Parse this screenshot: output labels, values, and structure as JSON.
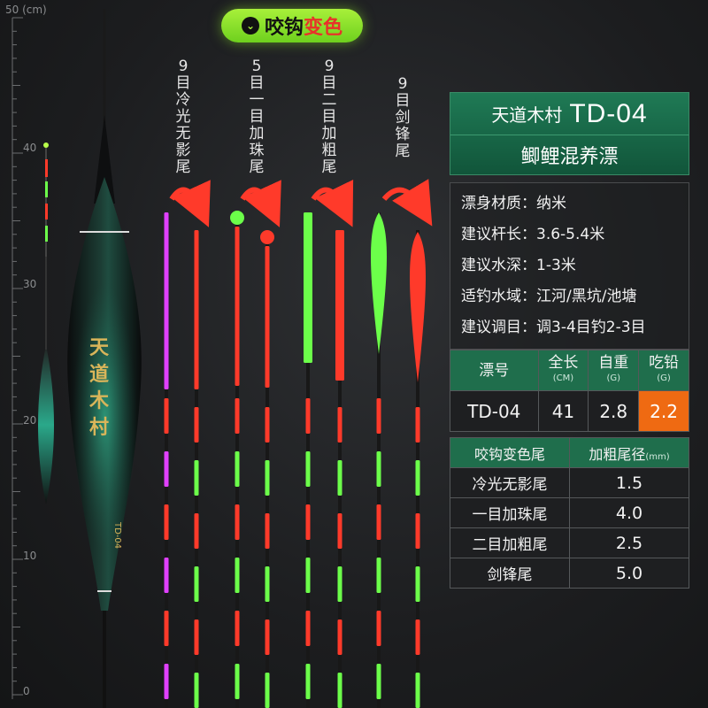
{
  "ruler": {
    "unit": "50 (cm)",
    "numbers": [
      "40",
      "30",
      "20",
      "10",
      "0"
    ]
  },
  "badge": {
    "icon": "chevron-down-icon",
    "text_a": "咬钩",
    "text_b": "变色"
  },
  "float_body_text": [
    "天",
    "道",
    "木",
    "村"
  ],
  "float_model_text": "TD-04",
  "tail_labels": [
    "9目冷光无影尾",
    "5目一目加珠尾",
    "9目二目加粗尾",
    "9目剑锋尾"
  ],
  "panel": {
    "brand": "天道木村",
    "model": "TD-04",
    "subtitle": "鲫鲤混养漂",
    "specs": [
      "漂身材质：纳米",
      "建议杆长：3.6-5.4米",
      "建议水深：1-3米",
      "适钓水域：江河/黑坑/池塘",
      "建议调目：调3-4目钓2-3目"
    ],
    "table_headers": [
      {
        "label": "漂号",
        "unit": ""
      },
      {
        "label": "全长",
        "unit": "(CM)"
      },
      {
        "label": "自重",
        "unit": "(G)"
      },
      {
        "label": "吃铅",
        "unit": "(G)"
      }
    ],
    "table_values": [
      "TD-04",
      "41",
      "2.8",
      "2.2"
    ],
    "tail_table_header": {
      "left": "咬钩变色尾",
      "right": "加粗尾径",
      "unit": "(mm)"
    },
    "tail_table_rows": [
      {
        "name": "冷光无影尾",
        "value": "1.5"
      },
      {
        "name": "一目加珠尾",
        "value": "4.0"
      },
      {
        "name": "二目加粗尾",
        "value": "2.5"
      },
      {
        "name": "剑锋尾",
        "value": "5.0"
      }
    ]
  },
  "colors": {
    "badge_green": "#a8f03a",
    "panel_green": "#1f6e4c",
    "highlight_orange": "#ef6a12",
    "tail_red": "#ff3a2a",
    "tail_green": "#6cff4a",
    "tail_purple": "#e040ff"
  }
}
